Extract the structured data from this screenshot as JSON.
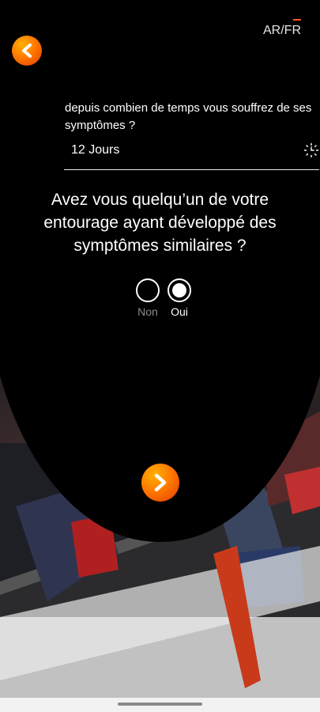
{
  "header": {
    "language_label": "AR/FR",
    "back_icon": "chevron-left-icon"
  },
  "duration": {
    "question": "depuis combien de temps vous souffrez de ses symptômes ?",
    "value": "12 Jours",
    "icon": "clock-icon"
  },
  "contact_question": {
    "text": "Avez vous quelqu’un de votre entourage ayant développé des symptômes similaires ?",
    "options": [
      {
        "label": "Non",
        "selected": false
      },
      {
        "label": "Oui",
        "selected": true
      }
    ]
  },
  "footer": {
    "next_icon": "chevron-right-icon"
  },
  "colors": {
    "accent": "#ff7a00",
    "background": "#000000"
  }
}
